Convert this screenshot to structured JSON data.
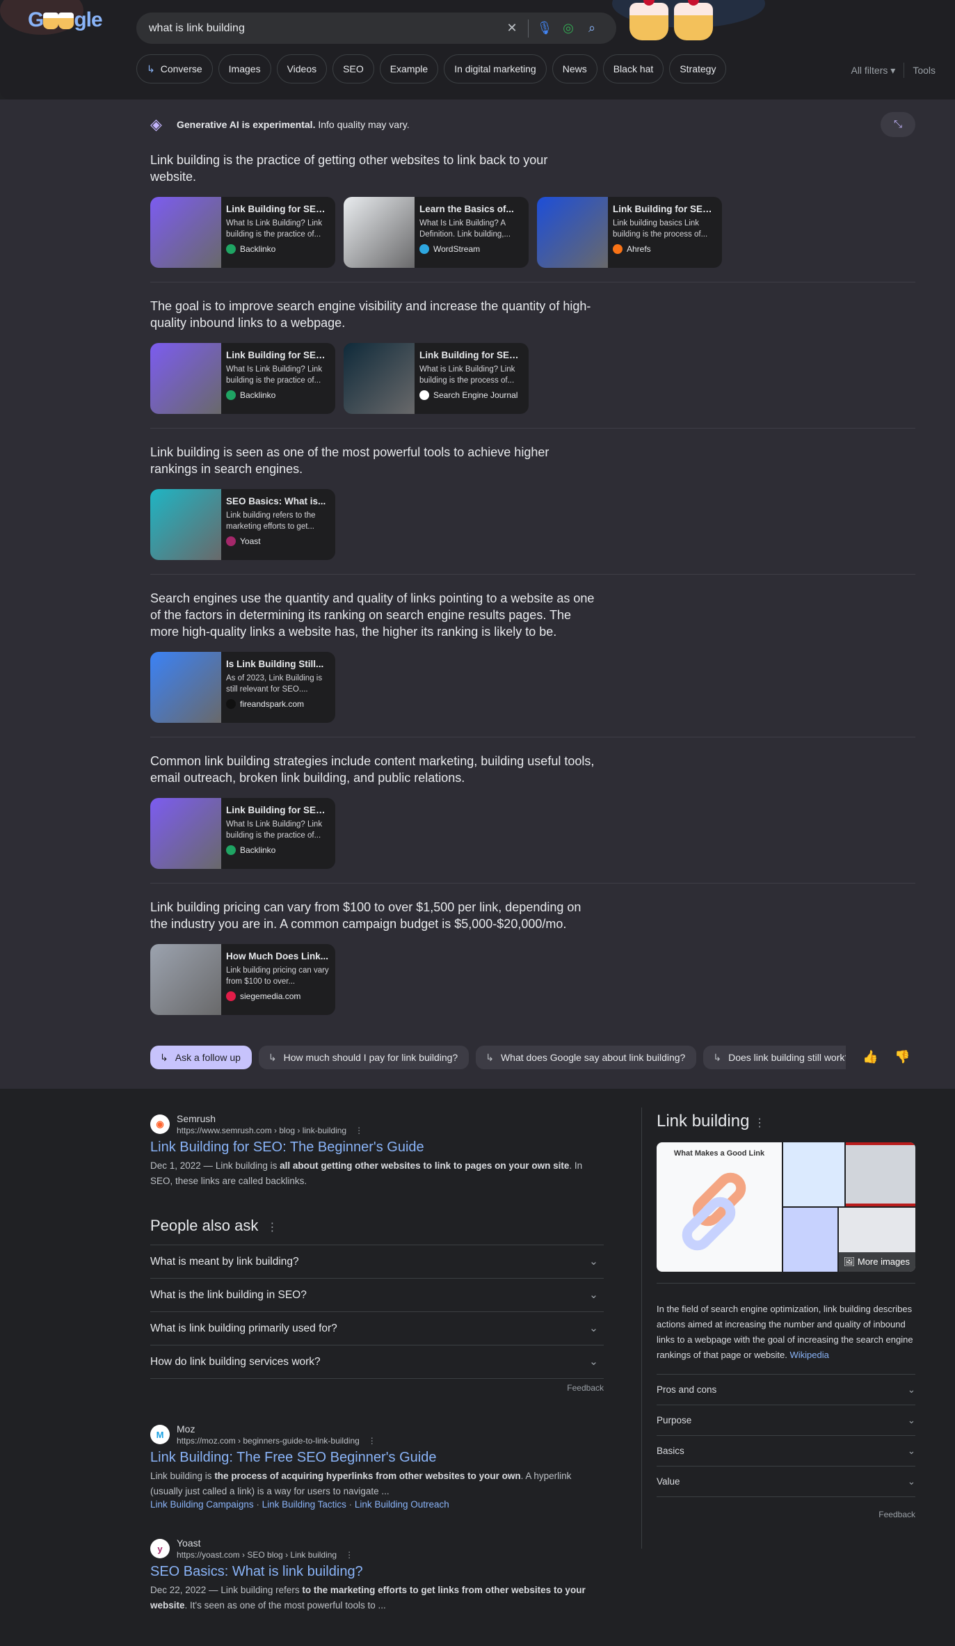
{
  "search": {
    "query": "what is link building",
    "logo": "Google"
  },
  "chips": [
    {
      "label": "Converse",
      "arrow": true
    },
    {
      "label": "Images"
    },
    {
      "label": "Videos"
    },
    {
      "label": "SEO"
    },
    {
      "label": "Example"
    },
    {
      "label": "In digital marketing"
    },
    {
      "label": "News"
    },
    {
      "label": "Black hat"
    },
    {
      "label": "Strategy"
    }
  ],
  "filters": {
    "all_filters": "All filters",
    "tools": "Tools"
  },
  "ai": {
    "notice_bold": "Generative AI is experimental.",
    "notice_rest": " Info quality may vary.",
    "blocks": [
      {
        "text": "Link building is the practice of getting other websites to link back to your website.",
        "cards": [
          {
            "title": "Link Building for SEO...",
            "desc": "What Is Link Building? Link building is the practice of...",
            "source": "Backlinko",
            "thumb_color": "#7c5cf0",
            "favicon_color": "#1fa463"
          },
          {
            "title": "Learn the Basics of...",
            "desc": "What Is Link Building? A Definition. Link building,...",
            "source": "WordStream",
            "thumb_color": "#e9ecef",
            "favicon_color": "#2ea7e0"
          },
          {
            "title": "Link Building for SEO...",
            "desc": "Link building basics Link building is the process of...",
            "source": "Ahrefs",
            "thumb_color": "#1d4ed8",
            "favicon_color": "#f97316"
          }
        ]
      },
      {
        "text": "The goal is to improve search engine visibility and increase the quantity of high-quality inbound links to a webpage.",
        "cards": [
          {
            "title": "Link Building for SEO...",
            "desc": "What Is Link Building? Link building is the practice of...",
            "source": "Backlinko",
            "thumb_color": "#7c5cf0",
            "favicon_color": "#1fa463"
          },
          {
            "title": "Link Building for SEO...",
            "desc": "What is Link Building? Link building is the process of...",
            "source": "Search Engine Journal",
            "thumb_color": "#0f2a3a",
            "favicon_color": "#ffffff"
          }
        ]
      },
      {
        "text": "Link building is seen as one of the most powerful tools to achieve higher rankings in search engines.",
        "cards": [
          {
            "title": "SEO Basics: What is...",
            "desc": "Link building refers to the marketing efforts to get...",
            "source": "Yoast",
            "thumb_color": "#1fb5c4",
            "favicon_color": "#a4286a"
          }
        ]
      },
      {
        "text": "Search engines use the quantity and quality of links pointing to a website as one of the factors in determining its ranking on search engine results pages. The more high-quality links a website has, the higher its ranking is likely to be.",
        "cards": [
          {
            "title": "Is Link Building Still...",
            "desc": "As of 2023, Link Building is still relevant for SEO....",
            "source": "fireandspark.com",
            "thumb_color": "#3b82f6",
            "favicon_color": "#111111"
          }
        ]
      },
      {
        "text": "Common link building strategies include content marketing, building useful tools, email outreach, broken link building, and public relations.",
        "cards": [
          {
            "title": "Link Building for SEO...",
            "desc": "What Is Link Building? Link building is the practice of...",
            "source": "Backlinko",
            "thumb_color": "#7c5cf0",
            "favicon_color": "#1fa463"
          }
        ]
      },
      {
        "text": "Link building pricing can vary from $100 to over $1,500 per link, depending on the industry you are in. A common campaign budget is $5,000-$20,000/mo.",
        "cards": [
          {
            "title": "How Much Does Link...",
            "desc": "Link building pricing can vary from $100 to over...",
            "source": "siegemedia.com",
            "thumb_color": "#9ca3af",
            "favicon_color": "#e11d48"
          }
        ]
      }
    ],
    "followups": [
      "Ask a follow up",
      "How much should I pay for link building?",
      "What does Google say about link building?",
      "Does link building still work?"
    ]
  },
  "results": [
    {
      "site": "Semrush",
      "url": "https://www.semrush.com › blog › link-building",
      "title": "Link Building for SEO: The Beginner's Guide",
      "date": "Dec 1, 2022 — ",
      "pre": "Link building is ",
      "bold": "all about getting other websites to link to pages on your own site",
      "post": ". In SEO, these links are called backlinks.",
      "favicon_color": "#ff642d",
      "favicon_letter": "◉"
    },
    {
      "site": "Moz",
      "url": "https://moz.com › beginners-guide-to-link-building",
      "title": "Link Building: The Free SEO Beginner's Guide",
      "date": "",
      "pre": "Link building is ",
      "bold": "the process of acquiring hyperlinks from other websites to your own",
      "post": ". A hyperlink (usually just called a link) is a way for users to navigate ...",
      "sitelinks": [
        "Link Building Campaigns",
        "Link Building Tactics",
        "Link Building Outreach"
      ],
      "favicon_color": "#1ba1e2",
      "favicon_letter": "M"
    },
    {
      "site": "Yoast",
      "url": "https://yoast.com › SEO blog › Link building",
      "title": "SEO Basics: What is link building?",
      "date": "Dec 22, 2022 — ",
      "pre": "Link building refers ",
      "bold": "to the marketing efforts to get links from other websites to your website",
      "post": ". It's seen as one of the most powerful tools to ...",
      "favicon_color": "#a4286a",
      "favicon_letter": "y"
    }
  ],
  "paa": {
    "title": "People also ask",
    "questions": [
      "What is meant by link building?",
      "What is the link building in SEO?",
      "What is link building primarily used for?",
      "How do link building services work?"
    ],
    "feedback": "Feedback"
  },
  "knowledge_panel": {
    "title": "Link building",
    "image_caption": "What Makes a Good Link",
    "more_images": "More images",
    "description": "In the field of search engine optimization, link building describes actions aimed at increasing the number and quality of inbound links to a webpage with the goal of increasing the search engine rankings of that page or website. ",
    "source": "Wikipedia",
    "rows": [
      "Pros and cons",
      "Purpose",
      "Basics",
      "Value"
    ],
    "feedback": "Feedback"
  }
}
